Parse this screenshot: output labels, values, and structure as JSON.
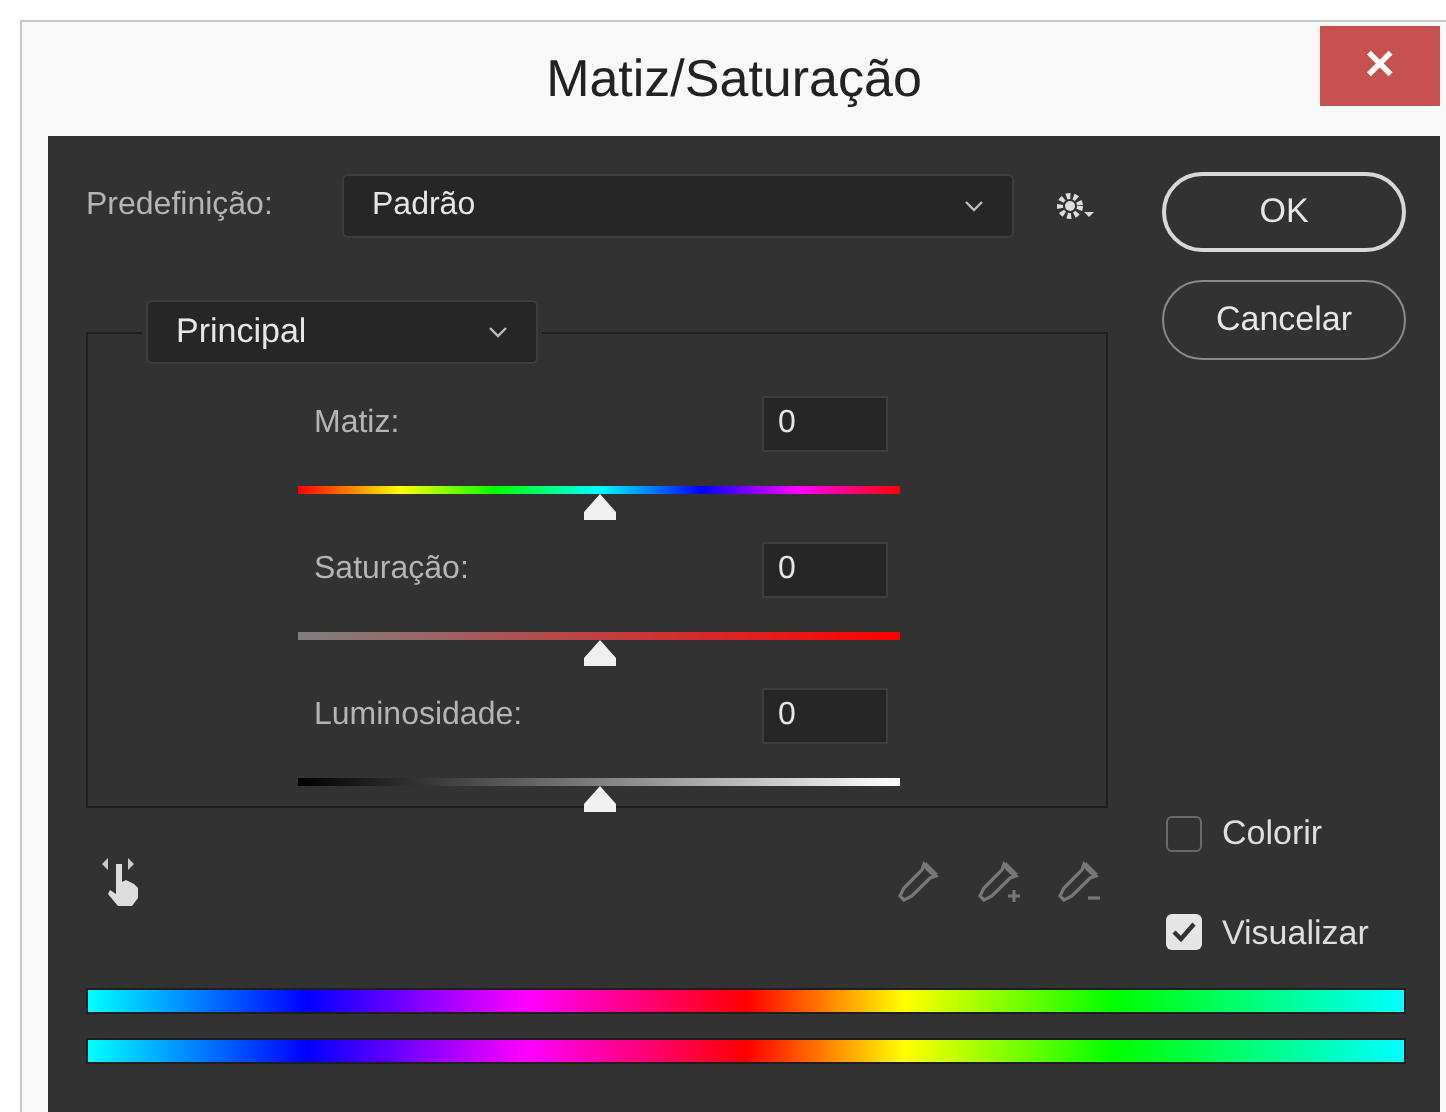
{
  "window": {
    "title": "Matiz/Saturação",
    "close": "✕"
  },
  "preset": {
    "label": "Predefinição:",
    "value": "Padrão"
  },
  "buttons": [
    {
      "label": "OK",
      "default": true
    },
    {
      "label": "Cancelar",
      "default": false
    }
  ],
  "channel": {
    "value": "Principal"
  },
  "sliders": [
    {
      "kind": "hue",
      "label": "Matiz:",
      "value": "0",
      "level": 0.5
    },
    {
      "kind": "saturation",
      "label": "Saturação:",
      "value": "0",
      "level": 0.5
    },
    {
      "kind": "lightness",
      "label": "Luminosidade:",
      "value": "0",
      "level": 0.5
    }
  ],
  "options": [
    {
      "label": "Colorir",
      "checked": false
    },
    {
      "label": "Visualizar",
      "checked": true
    }
  ]
}
